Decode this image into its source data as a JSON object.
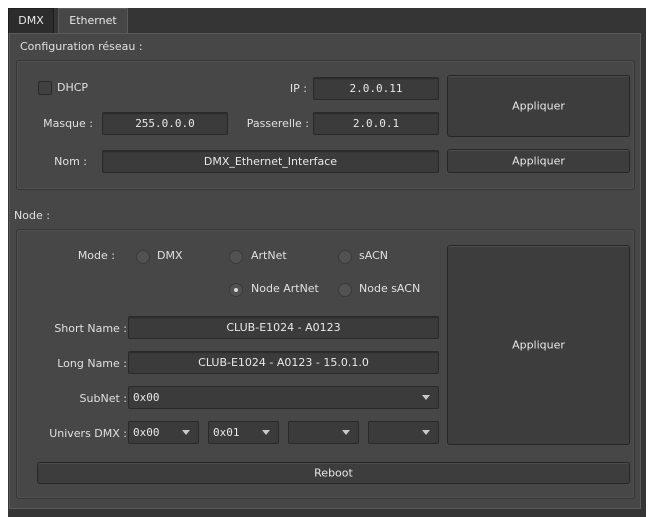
{
  "tabs": [
    {
      "label": "DMX"
    },
    {
      "label": "Ethernet"
    }
  ],
  "network": {
    "section_label": "Configuration réseau :",
    "dhcp_label": "DHCP",
    "dhcp_checked": false,
    "ip_label": "IP :",
    "ip_value": "2.0.0.11",
    "mask_label": "Masque :",
    "mask_value": "255.0.0.0",
    "gateway_label": "Passerelle :",
    "gateway_value": "2.0.0.1",
    "apply_label": "Appliquer",
    "name_label": "Nom :",
    "name_value": "DMX_Ethernet_Interface",
    "apply_name_label": "Appliquer"
  },
  "node": {
    "section_label": "Node :",
    "mode_label": "Mode :",
    "modes": [
      {
        "label": "DMX",
        "checked": false
      },
      {
        "label": "ArtNet",
        "checked": false
      },
      {
        "label": "sACN",
        "checked": false
      },
      {
        "label": "Node ArtNet",
        "checked": true
      },
      {
        "label": "Node sACN",
        "checked": false
      }
    ],
    "short_name_label": "Short Name :",
    "short_name_value": "CLUB-E1024 - A0123",
    "long_name_label": "Long Name :",
    "long_name_value": "CLUB-E1024 - A0123 - 15.0.1.0",
    "subnet_label": "SubNet :",
    "subnet_value": "0x00",
    "univers_label": "Univers DMX :",
    "univers_values": [
      "0x00",
      "0x01",
      "",
      ""
    ],
    "apply_label": "Appliquer",
    "reboot_label": "Reboot"
  }
}
